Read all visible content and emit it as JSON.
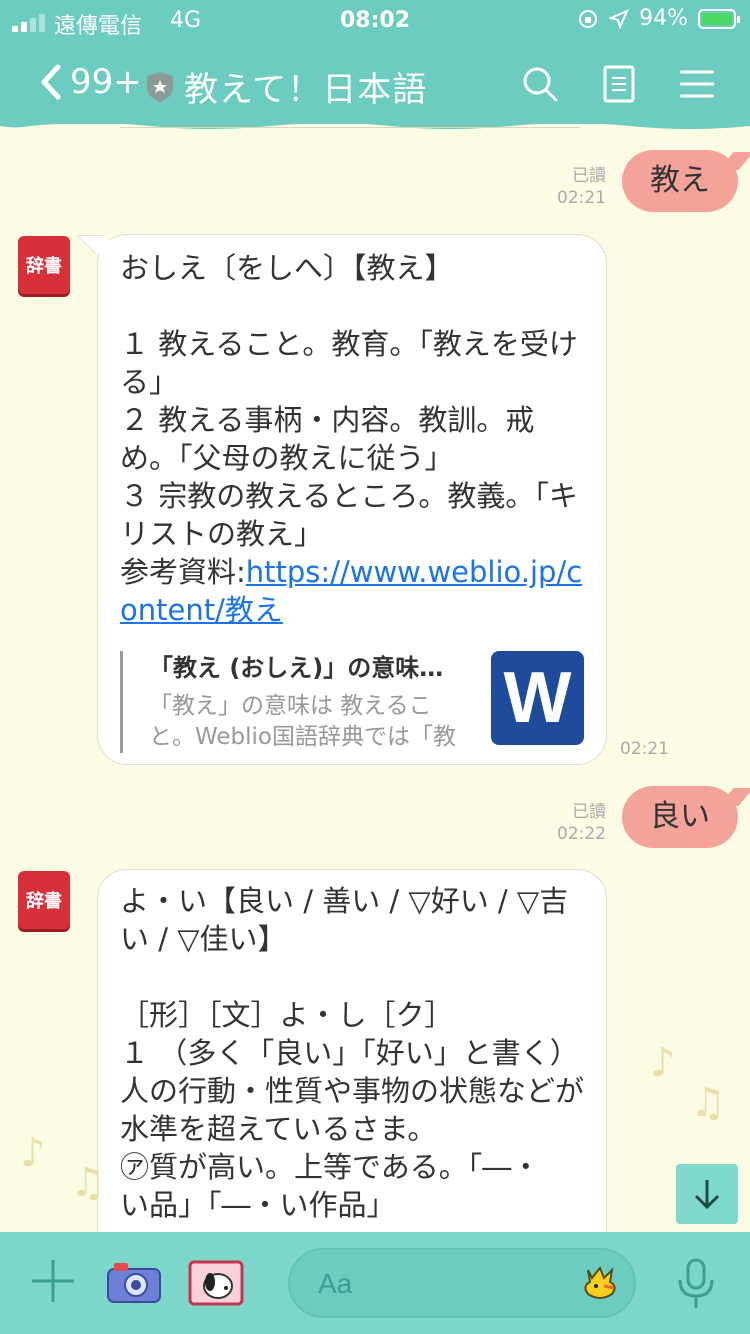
{
  "status_bar": {
    "carrier": "遠傳電信",
    "network": "4G",
    "time": "08:02",
    "battery": "94%"
  },
  "header": {
    "back_count": "99+",
    "title": "教えて！日本語"
  },
  "messages": {
    "out1": {
      "text": "教え",
      "read": "已讀",
      "time": "02:21"
    },
    "in1": {
      "avatar": "辞書",
      "line1": "おしえ〔をしへ〕【教え】",
      "line2": "１ 教えること。教育。「教えを受ける」",
      "line3": "２ 教える事柄・内容。教訓。戒め。「父母の教えに従う」",
      "line4": "３ 宗教の教えるところ。教義。「キリストの教え」",
      "ref_label": "参考資料:",
      "ref_link": "https://www.weblio.jp/content/教え",
      "preview_title": "「教え (おしえ)」の意味や使い方 Weblio辞書",
      "preview_desc": "「教え」の意味は 教えること。Weblio国語辞典では「教え」の意味や使い方",
      "preview_logo": "W",
      "time": "02:21"
    },
    "out2": {
      "text": "良い",
      "read": "已讀",
      "time": "02:22"
    },
    "in2": {
      "avatar": "辞書",
      "line1": "よ・い【良い / 善い / ▽好い / ▽吉い / ▽佳い】",
      "line2": "［形］［文］よ・し［ク］",
      "line3": "１ （多く「良い」「好い」と書く）人の行動・性質や事物の状態などが水準を超えているさま。",
      "line4": "㋐質が高い。上等である。「―・",
      "line5": "い品」「―・い作品」"
    }
  },
  "input": {
    "placeholder": "Aa"
  },
  "icons": {
    "back": "chevron-left-icon",
    "search": "search-icon",
    "notes": "notes-icon",
    "menu": "menu-icon",
    "add": "plus-icon",
    "camera": "camera-icon",
    "photo": "photo-icon",
    "sticker": "sticker-icon",
    "mic": "microphone-icon",
    "scroll_down": "arrow-down-icon"
  }
}
